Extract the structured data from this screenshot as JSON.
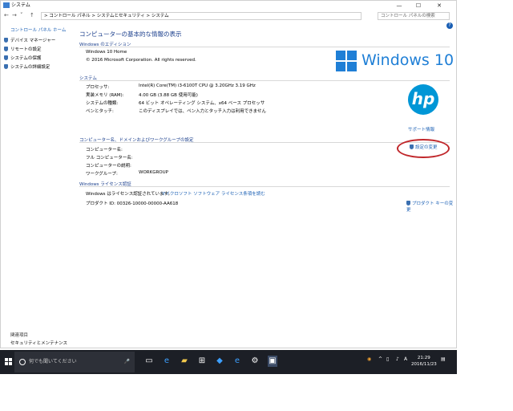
{
  "window": {
    "title": "システム",
    "min": "—",
    "max": "☐",
    "close": "✕"
  },
  "address": {
    "path": "> コントロール パネル > システムとセキュリティ > システム",
    "search_placeholder": "コントロール パネルの検索"
  },
  "sidebar": {
    "home": "コントロール パネル ホーム",
    "items": [
      {
        "label": "デバイス マネージャー"
      },
      {
        "label": "リモートの設定"
      },
      {
        "label": "システムの保護"
      },
      {
        "label": "システムの詳細設定"
      }
    ],
    "footer_title": "関連項目",
    "footer_link": "セキュリティとメンテナンス"
  },
  "main": {
    "page_title": "コンピューターの基本的な情報の表示",
    "edition": {
      "heading": "Windows のエディション",
      "name": "Windows 10 Home",
      "copyright": "© 2016 Microsoft Corporation. All rights reserved."
    },
    "logo_text": "Windows 10",
    "hp_logo": "hp",
    "system": {
      "heading": "システム",
      "rows": [
        {
          "label": "プロセッサ:",
          "value": "Intel(R) Core(TM) i3-6100T CPU @ 3.20GHz   3.19 GHz"
        },
        {
          "label": "実装メモリ (RAM):",
          "value": "4.00 GB (3.88 GB 使用可能)"
        },
        {
          "label": "システムの種類:",
          "value": "64 ビット オペレーティング システム、x64 ベース プロセッサ"
        },
        {
          "label": "ペンとタッチ:",
          "value": "このディスプレイでは、ペン入力とタッチ入力は利用できません"
        }
      ],
      "support_link": "サポート情報"
    },
    "computer": {
      "heading": "コンピューター名、ドメインおよびワークグループの設定",
      "rows": [
        {
          "label": "コンピューター名:",
          "value": ""
        },
        {
          "label": "フル コンピューター名:",
          "value": ""
        },
        {
          "label": "コンピューターの説明:",
          "value": ""
        },
        {
          "label": "ワークグループ:",
          "value": "WORKGROUP"
        }
      ],
      "change_link": "設定の変更"
    },
    "license": {
      "heading": "Windows ライセンス認証",
      "status": "Windows はライセンス認証されています。",
      "terms_link": "マイクロソフト ソフトウェア ライセンス条項を読む",
      "product_id": "プロダクト ID: 00326-10000-00000-AA618",
      "product_key_link": "プロダクト キーの変更"
    }
  },
  "taskbar": {
    "search_placeholder": "何でも聞いてください",
    "time": "21:29",
    "date": "2016/11/23",
    "ime": "A"
  },
  "colors": {
    "accent": "#1f7fd6",
    "link": "#1a5fb4",
    "heading": "#1a3e8c",
    "annotation": "#c0262a",
    "taskbar": "#1c1f26"
  }
}
